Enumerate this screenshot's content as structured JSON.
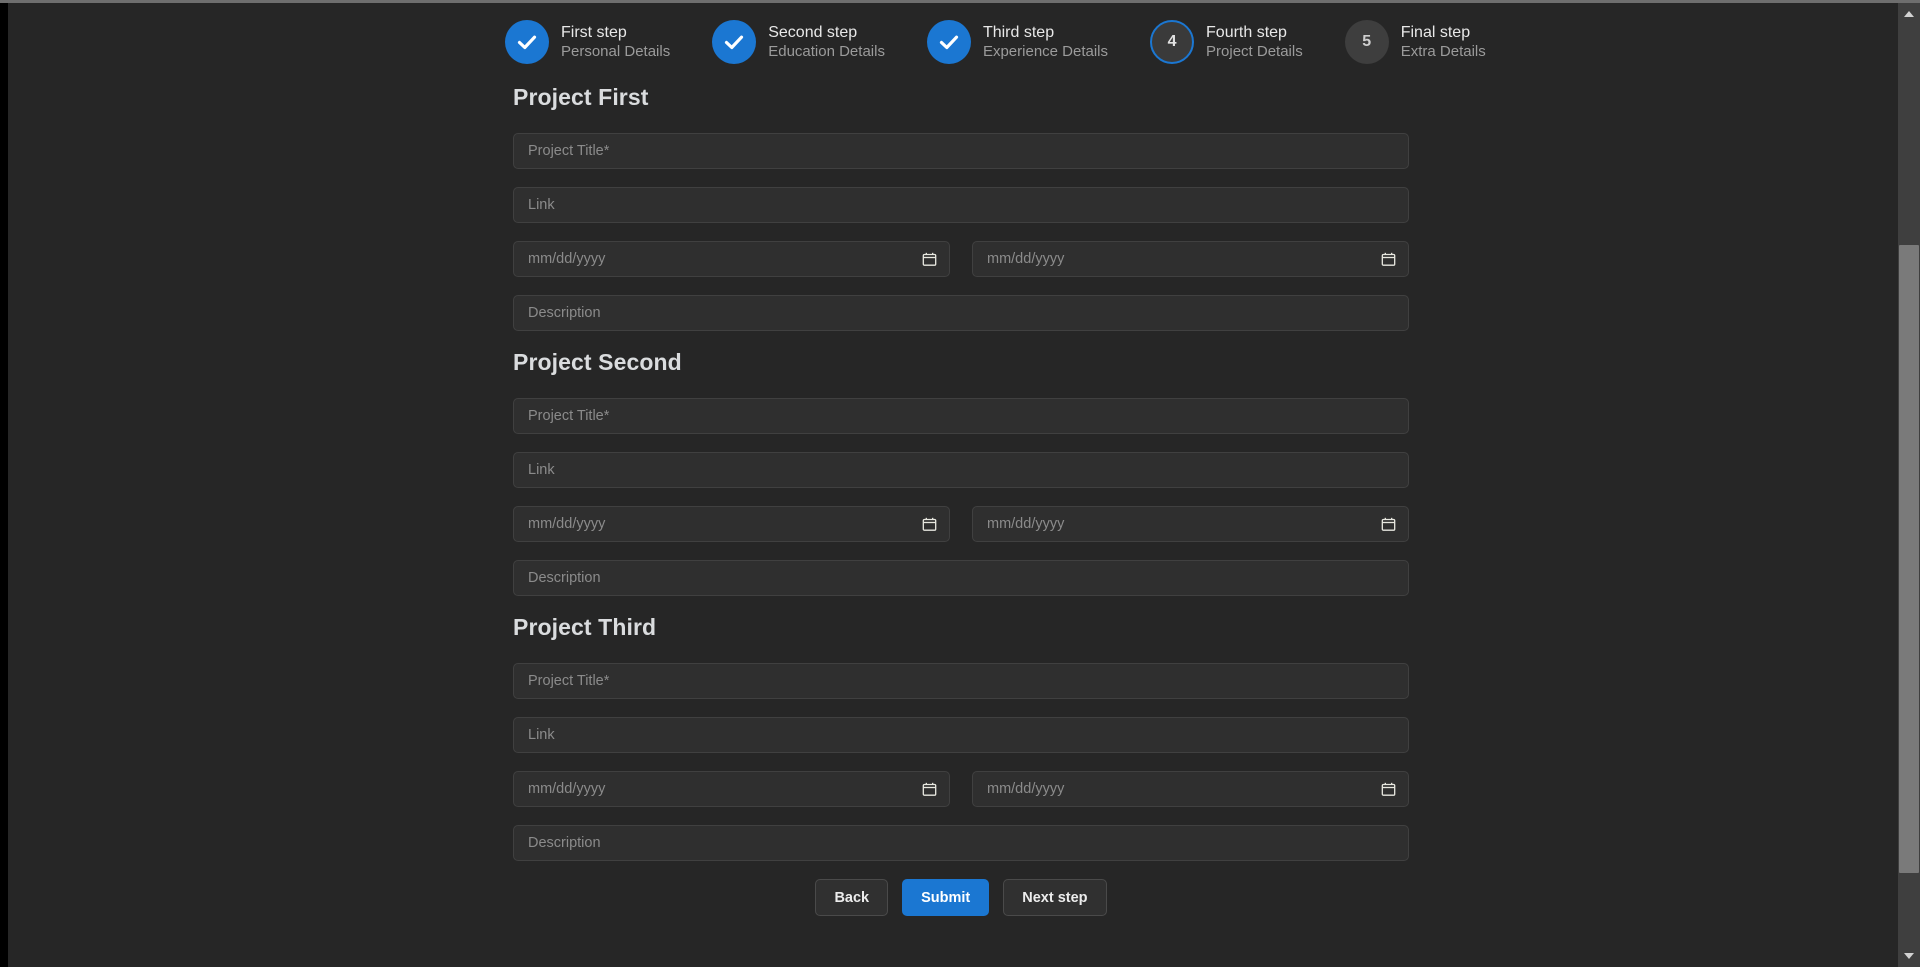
{
  "stepper": {
    "steps": [
      {
        "title": "First step",
        "subtitle": "Personal Details",
        "state": "done",
        "marker": "check"
      },
      {
        "title": "Second step",
        "subtitle": "Education Details",
        "state": "done",
        "marker": "check"
      },
      {
        "title": "Third step",
        "subtitle": "Experience Details",
        "state": "done",
        "marker": "check"
      },
      {
        "title": "Fourth step",
        "subtitle": "Project Details",
        "state": "active",
        "marker": "4"
      },
      {
        "title": "Final step",
        "subtitle": "Extra Details",
        "state": "todo",
        "marker": "5"
      }
    ]
  },
  "sections": [
    {
      "heading": "Project First",
      "title_placeholder": "Project Title*",
      "title_value": "",
      "link_placeholder": "Link",
      "link_value": "",
      "start_date_placeholder": "mm/dd/yyyy",
      "start_date_value": "",
      "end_date_placeholder": "mm/dd/yyyy",
      "end_date_value": "",
      "description_placeholder": "Description",
      "description_value": ""
    },
    {
      "heading": "Project Second",
      "title_placeholder": "Project Title*",
      "title_value": "",
      "link_placeholder": "Link",
      "link_value": "",
      "start_date_placeholder": "mm/dd/yyyy",
      "start_date_value": "",
      "end_date_placeholder": "mm/dd/yyyy",
      "end_date_value": "",
      "description_placeholder": "Description",
      "description_value": ""
    },
    {
      "heading": "Project Third",
      "title_placeholder": "Project Title*",
      "title_value": "",
      "link_placeholder": "Link",
      "link_value": "",
      "start_date_placeholder": "mm/dd/yyyy",
      "start_date_value": "",
      "end_date_placeholder": "mm/dd/yyyy",
      "end_date_value": "",
      "description_placeholder": "Description",
      "description_value": ""
    }
  ],
  "actions": {
    "back_label": "Back",
    "submit_label": "Submit",
    "next_label": "Next step"
  },
  "colors": {
    "accent": "#1b77d2",
    "page_background": "#262626",
    "field_background": "#2f2f2f",
    "field_border": "#404040",
    "heading_text": "#dadcde",
    "placeholder_text": "#8b8b8b"
  },
  "icons": {
    "step_done": "check-icon",
    "calendar": "calendar-icon",
    "scroll_up": "scroll-up-arrow-icon",
    "scroll_down": "scroll-down-arrow-icon"
  }
}
